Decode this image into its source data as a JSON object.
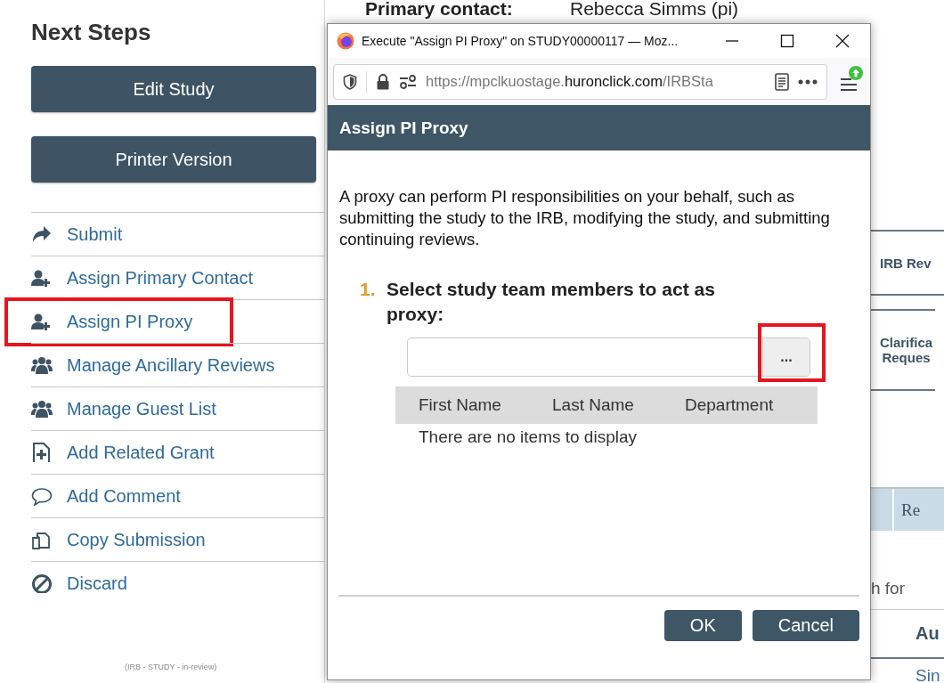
{
  "background_page": {
    "primary_contact_label": "Primary contact:",
    "primary_contact_value": "Rebecca Simms (pi)",
    "next_steps": {
      "title": "Next Steps",
      "buttons": [
        "Edit Study",
        "Printer Version"
      ],
      "actions": [
        {
          "label": "Submit",
          "kind": "submit",
          "highlighted": false
        },
        {
          "label": "Assign Primary Contact",
          "kind": "assign",
          "highlighted": false
        },
        {
          "label": "Assign PI Proxy",
          "kind": "assign",
          "highlighted": true
        },
        {
          "label": "Manage Ancillary Reviews",
          "kind": "manage",
          "highlighted": false
        },
        {
          "label": "Manage Guest List",
          "kind": "manage",
          "highlighted": false
        },
        {
          "label": "Add Related Grant",
          "kind": "add-file",
          "highlighted": false
        },
        {
          "label": "Add Comment",
          "kind": "comment",
          "highlighted": false
        },
        {
          "label": "Copy Submission",
          "kind": "copy",
          "highlighted": false
        },
        {
          "label": "Discard",
          "kind": "discard",
          "highlighted": false
        }
      ],
      "footer": "(IRB - STUDY - in-review)"
    },
    "right_strip": {
      "review_cells": [
        "IRB Rev",
        "Clarifica Reques"
      ],
      "activity_header": "Re",
      "search_label": "h for",
      "column_header": "Au",
      "column_cell": "Sin"
    }
  },
  "popup": {
    "window_title": "Execute \"Assign PI Proxy\" on STUDY00000117 — Moz...",
    "url": {
      "prefix": "https://mpclkuostage.",
      "domain": "huronclick.com",
      "path": "/IRBSta"
    },
    "update_available": true,
    "dialog_title": "Assign PI Proxy",
    "description": "A proxy can perform PI responsibilities on your behalf, such as submitting the study to the IRB, modifying the study, and submitting continuing reviews.",
    "step": {
      "number": "1.",
      "label": "Select study team members to act as proxy:"
    },
    "browse_button": {
      "label": "...",
      "highlighted": true
    },
    "table": {
      "columns": [
        "First Name",
        "Last Name",
        "Department"
      ],
      "empty_message": "There are no items to display"
    },
    "buttons": [
      "OK",
      "Cancel"
    ]
  }
}
